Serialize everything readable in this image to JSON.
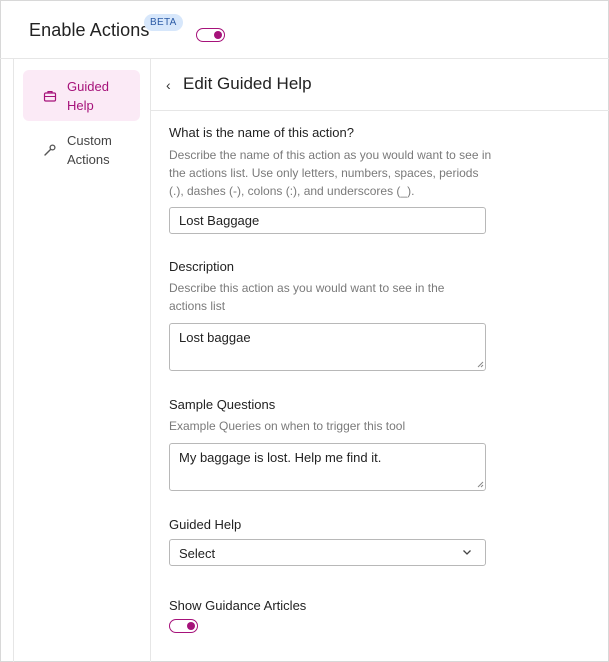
{
  "header": {
    "title": "Enable Actions",
    "badge": "BETA",
    "enabled": true
  },
  "sidebar": {
    "items": [
      {
        "label": "Guided Help",
        "icon": "briefcase-icon",
        "active": true
      },
      {
        "label": "Custom Actions",
        "icon": "wrench-icon",
        "active": false
      }
    ]
  },
  "main": {
    "title": "Edit Guided Help",
    "name_field": {
      "label": "What is the name of this action?",
      "help": "Describe the name of this action as you would want to see in the actions list. Use only letters, numbers, spaces, periods (.), dashes (-), colons (:), and underscores (_).",
      "value": "Lost Baggage"
    },
    "description_field": {
      "label": "Description",
      "help": "Describe this action as you would want to see in the actions list",
      "value": "Lost baggae"
    },
    "sample_questions_field": {
      "label": "Sample Questions",
      "help": "Example Queries on when to trigger this tool",
      "value": "My baggage is lost. Help me find it."
    },
    "guided_help_field": {
      "label": "Guided Help",
      "selected": "Select"
    },
    "guidance_articles": {
      "label": "Show Guidance Articles",
      "enabled": true
    }
  },
  "colors": {
    "accent": "#a6127a",
    "active_bg": "#fbeaf6",
    "badge_bg": "#d7e7fb",
    "badge_text": "#2b5aa5"
  }
}
